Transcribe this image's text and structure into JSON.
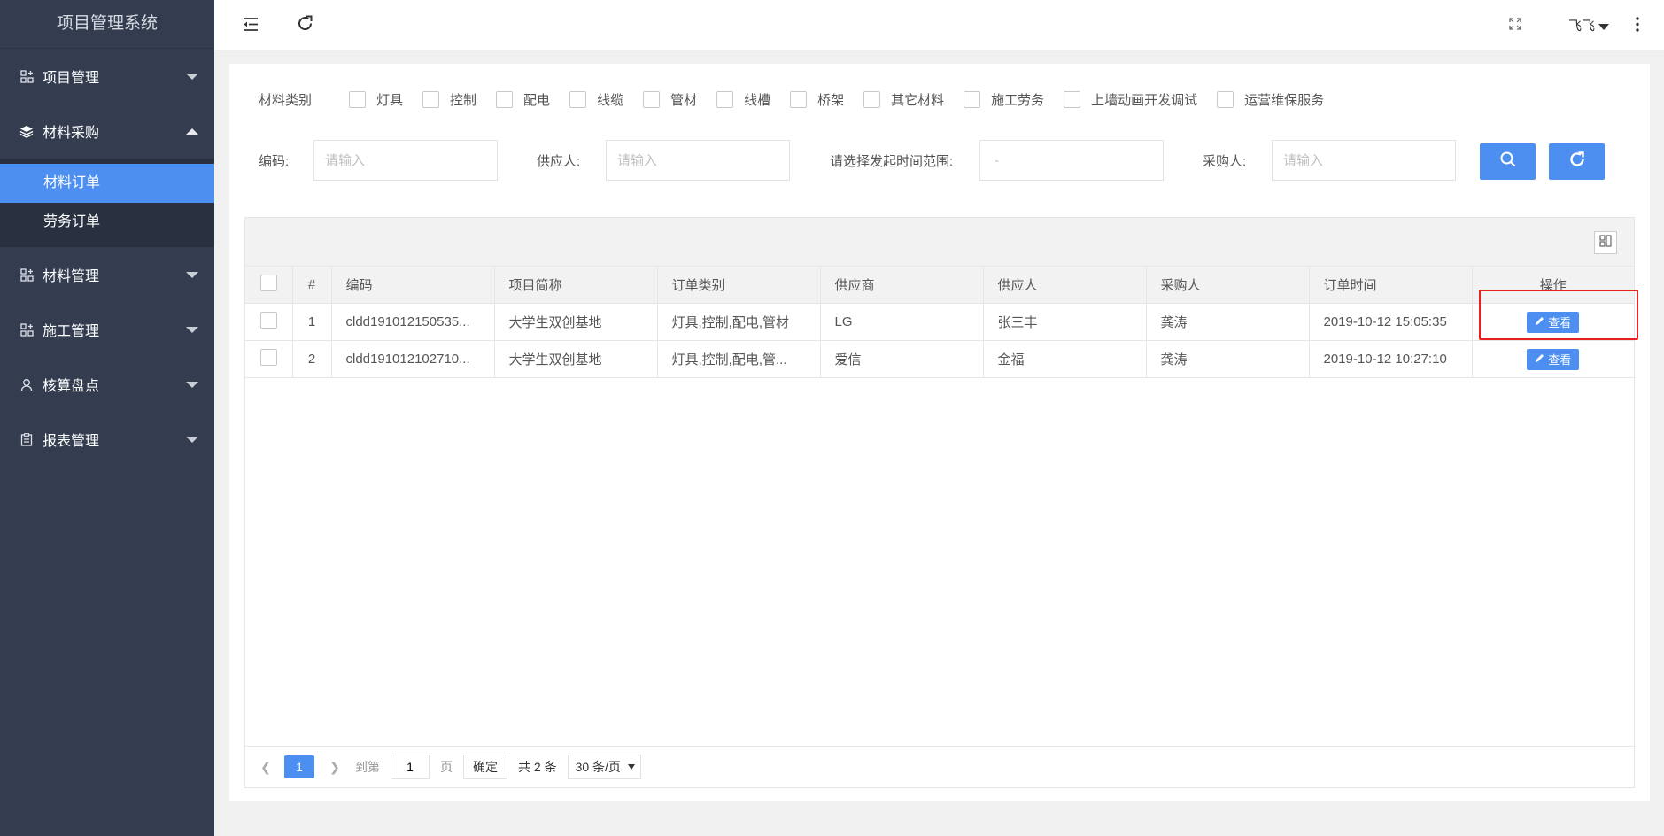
{
  "app": {
    "title": "项目管理系统"
  },
  "sidebar": {
    "items": [
      {
        "label": "项目管理",
        "icon": "grid-plus-icon"
      },
      {
        "label": "材料采购",
        "icon": "layers-icon",
        "children": [
          {
            "label": "材料订单",
            "active": true
          },
          {
            "label": "劳务订单",
            "active": false
          }
        ]
      },
      {
        "label": "材料管理",
        "icon": "grid-plus-icon"
      },
      {
        "label": "施工管理",
        "icon": "grid-plus-icon"
      },
      {
        "label": "核算盘点",
        "icon": "user-icon"
      },
      {
        "label": "报表管理",
        "icon": "clipboard-icon"
      }
    ]
  },
  "topbar": {
    "user": "飞飞"
  },
  "filters": {
    "category_label": "材料类别",
    "categories": [
      "灯具",
      "控制",
      "配电",
      "线缆",
      "管材",
      "线槽",
      "桥架",
      "其它材料",
      "施工劳务",
      "上墙动画开发调试",
      "运营维保服务"
    ],
    "code_label": "编码:",
    "code_placeholder": "请输入",
    "supplier_person_label": "供应人:",
    "supplier_person_placeholder": "请输入",
    "date_range_label": "请选择发起时间范围:",
    "date_range_placeholder": " - ",
    "buyer_label": "采购人:",
    "buyer_placeholder": "请输入"
  },
  "table": {
    "columns": [
      "#",
      "编码",
      "项目简称",
      "订单类别",
      "供应商",
      "供应人",
      "采购人",
      "订单时间",
      "操作"
    ],
    "rows": [
      {
        "no": "1",
        "code": "cldd191012150535...",
        "project": "大学生双创基地",
        "type": "灯具,控制,配电,管材",
        "supplier": "LG",
        "supplier_person": "张三丰",
        "buyer": "龚涛",
        "time": "2019-10-12 15:05:35",
        "action": "查看"
      },
      {
        "no": "2",
        "code": "cldd191012102710...",
        "project": "大学生双创基地",
        "type": "灯具,控制,配电,管...",
        "supplier": "爱信",
        "supplier_person": "金福",
        "buyer": "龚涛",
        "time": "2019-10-12 10:27:10",
        "action": "查看"
      }
    ]
  },
  "pager": {
    "current": "1",
    "goto_label": "到第",
    "goto_value": "1",
    "page_unit": "页",
    "confirm": "确定",
    "total": "共 2 条",
    "page_size": "30 条/页"
  },
  "colors": {
    "accent": "#4d8ff0",
    "sidebar": "#343d50",
    "highlight": "#e82020"
  }
}
